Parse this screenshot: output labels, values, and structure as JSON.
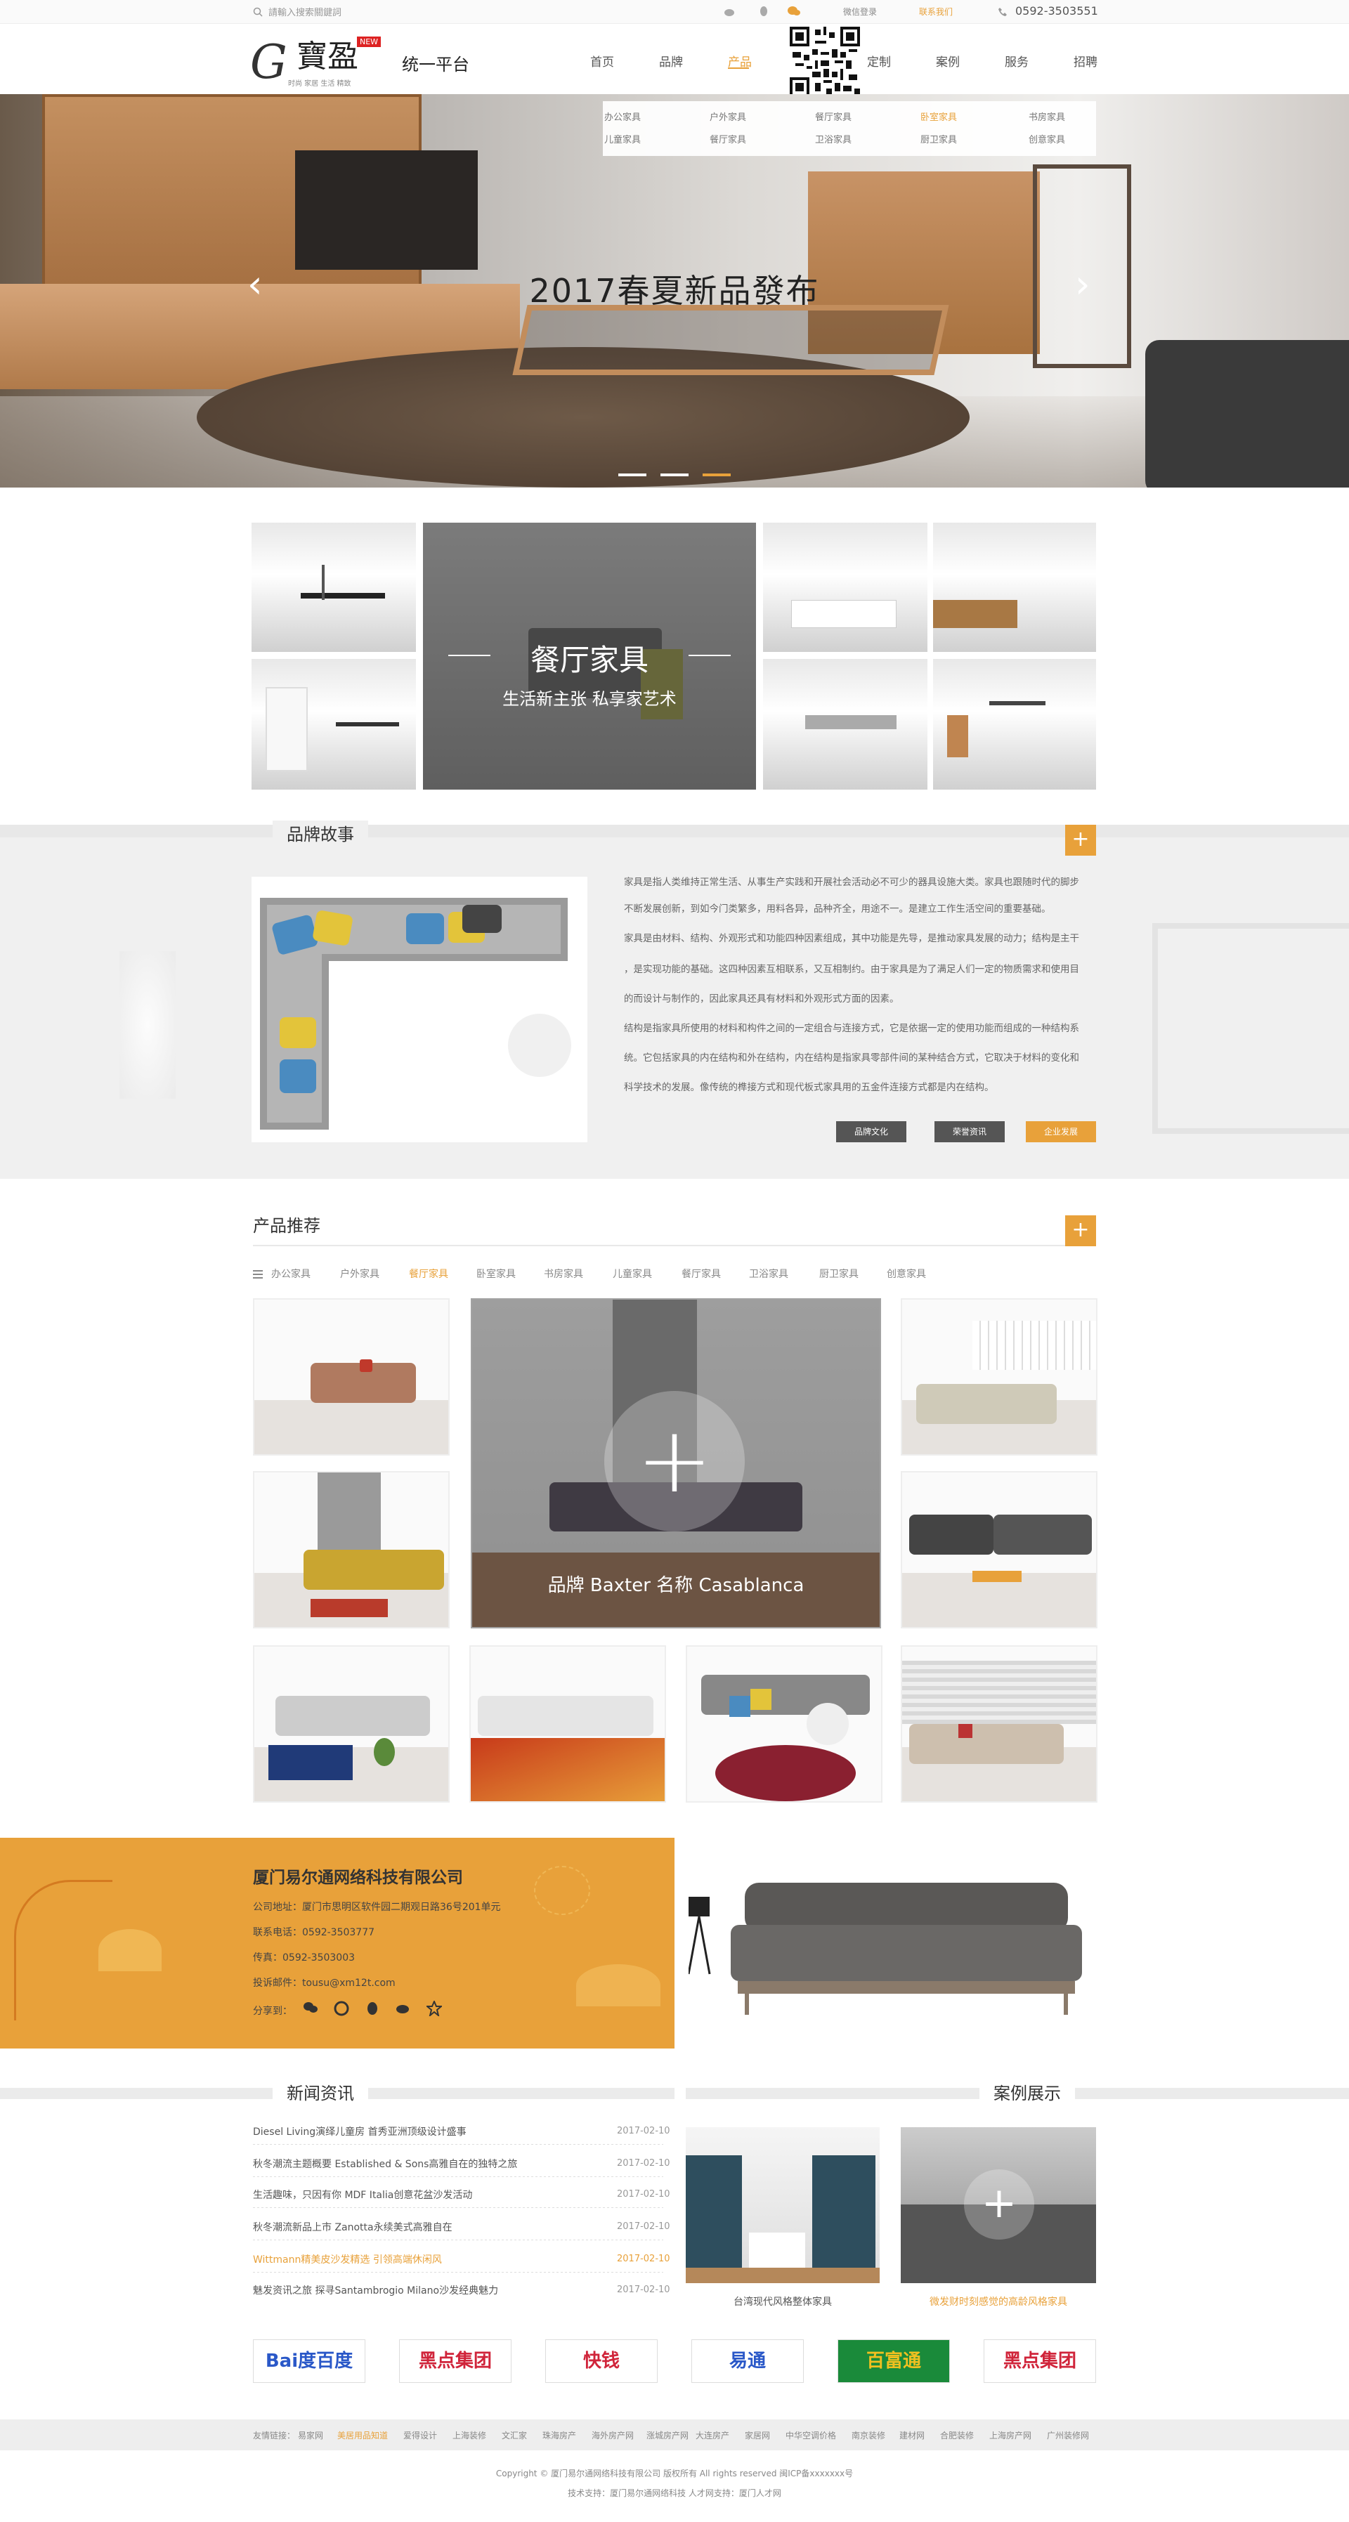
{
  "topbar": {
    "search_placeholder": "請輸入搜索關鍵詞",
    "links": [
      "微信登录",
      "联系我们"
    ],
    "phone": "0592-3503551"
  },
  "header": {
    "logo_g": "G",
    "logo_cn": "寶盈",
    "logo_new": "NEW",
    "logo_sub": "统一平台",
    "logo_tag": "时尚 家居 生活 精致",
    "nav": [
      "首页",
      "品牌",
      "产品",
      "定制",
      "案例",
      "服务",
      "招聘"
    ],
    "nav_active_index": 2
  },
  "dropdown": {
    "row1": [
      "办公家具",
      "户外家具",
      "餐厅家具",
      "卧室家具",
      "书房家具"
    ],
    "row2": [
      "儿童家具",
      "餐厅家具",
      "卫浴家具",
      "厨卫家具",
      "创意家具"
    ]
  },
  "hero": {
    "title": "2017春夏新品發布",
    "prev": "‹",
    "next": "›",
    "active_dot": 2
  },
  "mosaic": {
    "title": "餐厅家具",
    "subtitle": "生活新主张 私享家艺术"
  },
  "story": {
    "title": "品牌故事",
    "paragraphs": [
      "家具是指人类维持正常生活、从事生产实践和开展社会活动必不可少的器具设施大类。家具也跟随时代的脚步",
      "不断发展创新，到如今门类繁多，用料各异，品种齐全，用途不一。是建立工作生活空间的重要基础。",
      "家具是由材料、结构、外观形式和功能四种因素组成，其中功能是先导，是推动家具发展的动力；结构是主干",
      "，是实现功能的基础。这四种因素互相联系，又互相制约。由于家具是为了满足人们一定的物质需求和使用目",
      "的而设计与制作的，因此家具还具有材料和外观形式方面的因素。",
      "结构是指家具所使用的材料和构件之间的一定组合与连接方式，它是依据一定的使用功能而组成的一种结构系",
      "统。它包括家具的内在结构和外在结构，内在结构是指家具零部件间的某种结合方式，它取决于材料的变化和",
      "科学技术的发展。像传统的榫接方式和现代板式家具用的五金件连接方式都是内在结构。"
    ],
    "buttons": [
      "品牌文化",
      "荣誉资讯",
      "企业发展"
    ],
    "plus": "+"
  },
  "products": {
    "title": "产品推荐",
    "tabs": [
      "办公家具",
      "户外家具",
      "餐厅家具",
      "卧室家具",
      "书房家具",
      "儿童家具",
      "餐厅家具",
      "卫浴家具",
      "厨卫家具",
      "创意家具"
    ],
    "active_tab": 2,
    "feature_caption": "品牌 Baxter   名称 Casablanca",
    "plus": "+"
  },
  "contact": {
    "company": "厦门易尔通网络科技有限公司",
    "address": "公司地址：厦门市思明区软件园二期观日路36号201单元",
    "tel": "联系电话：0592-3503777",
    "fax": "传真：0592-3503003",
    "email": "投诉邮件：tousu@xm12t.com",
    "share_label": "分享到："
  },
  "news": {
    "title": "新闻资讯",
    "items": [
      {
        "text": "Diesel Living演绎儿童房 首秀亚洲顶级设计盛事",
        "date": "2017-02-10"
      },
      {
        "text": "秋冬潮流主题概要 Established & Sons高雅自在的独特之旅",
        "date": "2017-02-10"
      },
      {
        "text": "生活趣味，只因有你 MDF Italia创意花盆沙发活动",
        "date": "2017-02-10"
      },
      {
        "text": "秋冬潮流新品上市 Zanotta永续美式高雅自在",
        "date": "2017-02-10"
      },
      {
        "text": "Wittmann精美皮沙发精选 引领高端休闲风",
        "date": "2017-02-10"
      },
      {
        "text": "魅发资讯之旅 探寻Santambrogio Milano沙发经典魅力",
        "date": "2017-02-10"
      }
    ],
    "active_index": 4
  },
  "cases": {
    "title": "案例展示",
    "captions": [
      "台湾现代风格整体家具",
      "微发财时刻感觉的高龄风格家具"
    ],
    "plus": "+"
  },
  "partners": [
    "Bai度百度",
    "黑点集团",
    "快钱",
    "易通",
    "百富通",
    "黑点集团"
  ],
  "friend_links": {
    "label": "友情链接：",
    "items": [
      "易家网",
      "美居用品知道",
      "爱得设计",
      "上海装修",
      "文汇家",
      "珠海房产",
      "海外房产网",
      "涨城房产网",
      "大连房产",
      "家居网",
      "中华空调价格",
      "南京装修",
      "建材网",
      "合肥装修",
      "上海房产网",
      "广州装修网"
    ],
    "active_index": 1
  },
  "footer": {
    "line1": "Copyright © 厦门易尔通网络科技有限公司  版权所有  All rights reserved  闽ICP备xxxxxxx号",
    "line2": "技术支持：厦门易尔通网络科技  人才网支持：厦门人才网"
  },
  "colors": {
    "accent": "#e8a13a",
    "dark": "#333333",
    "button_gray": "#555555"
  }
}
